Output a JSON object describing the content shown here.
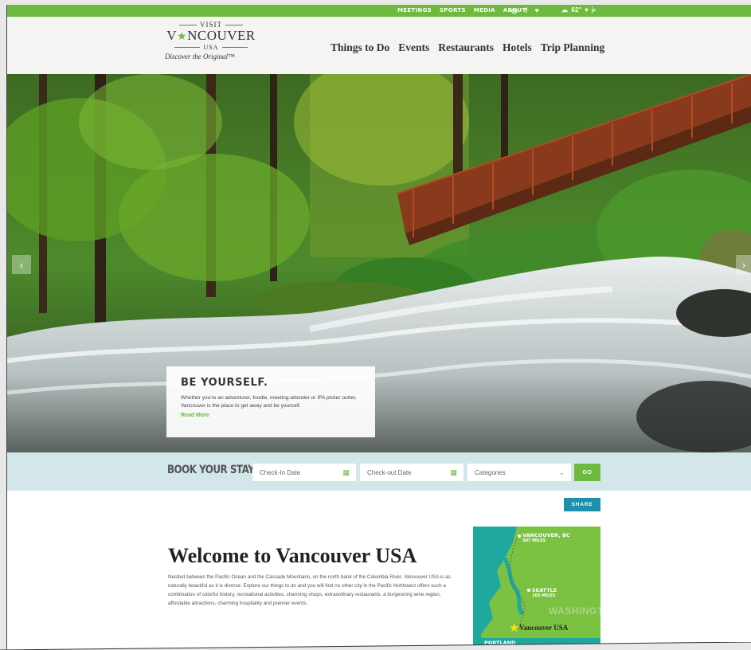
{
  "topbar": {
    "links": [
      "MEETINGS",
      "SPORTS",
      "MEDIA",
      "ABOUT"
    ],
    "social_icons": [
      "instagram-icon",
      "facebook-icon",
      "twitter-icon"
    ],
    "weather": "62°",
    "weather_icon": "cloud-sun-icon",
    "search_icon": "search-icon"
  },
  "logo": {
    "visit": "VISIT",
    "name_pre": "V",
    "name_post": "NCOUVER",
    "usa": "USA",
    "tagline": "Discover the Original™"
  },
  "nav": [
    "Things to Do",
    "Events",
    "Restaurants",
    "Hotels",
    "Trip Planning"
  ],
  "hero": {
    "prev": "‹",
    "next": "›",
    "promo": {
      "title": "BE YOURSELF.",
      "body": "Whether you're an adventurer, foodie, meeting-attender or IPA picker outter, Vancouver is the place to get away and be yourself.",
      "link": "Read More"
    }
  },
  "book": {
    "label": "BOOK YOUR STAY",
    "checkin": "Check-In Date",
    "checkout": "Check-out Date",
    "categories": "Categories",
    "go": "GO"
  },
  "share": "SHARE",
  "welcome": {
    "title": "Welcome to Vancouver USA",
    "body": "Nestled between the Pacific Ocean and the Cascade Mountains, on the north bank of the Columbia River, Vancouver USA is as naturally beautiful as it is diverse. Explore our things to do and you will find no other city in the Pacific Northwest offers such a combination of colorful history, recreational activities, charming shops, extraordinary restaurants, a burgeoning wine region, affordable attractions, charming hospitality and premier events."
  },
  "map": {
    "vancouver_bc": "VANCOUVER, BC",
    "vancouver_bc_miles": "307 MILES",
    "seattle": "SEATTLE",
    "seattle_miles": "165 MILES",
    "state": "WASHINGTON",
    "city": "Vancouver USA",
    "portland": "PORTLAND"
  },
  "colors": {
    "green": "#6dba3f",
    "teal": "#1e8fad",
    "book_bg": "#d3e7ea"
  }
}
